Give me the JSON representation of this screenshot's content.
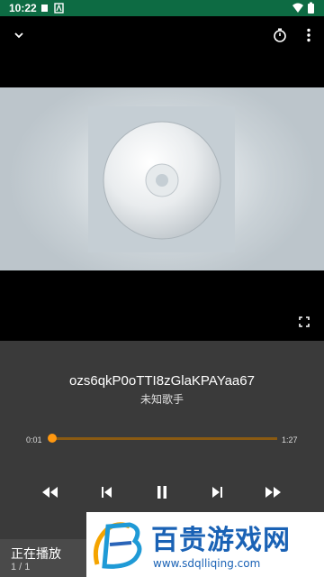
{
  "status_bar": {
    "time": "10:22"
  },
  "icons": {
    "collapse": "chevron-down-icon",
    "timer": "stopwatch-icon",
    "menu": "more-vert-icon",
    "fullscreen": "fullscreen-icon",
    "rewind": "rewind-icon",
    "previous": "skip-previous-icon",
    "pause": "pause-icon",
    "next": "skip-next-icon",
    "forward": "fast-forward-icon"
  },
  "track": {
    "title": "ozs6qkP0oTTI8zGlaKPAYaa67",
    "artist": "未知歌手"
  },
  "progress": {
    "current": "0:01",
    "duration": "1:27",
    "fraction": 0.0115
  },
  "colors": {
    "accent": "#ff9810",
    "status_bar": "#0d6b43",
    "panel": "#3a3a3a"
  },
  "now_playing": {
    "label": "正在播放",
    "count": "1 / 1"
  },
  "watermark": {
    "text": "百贵游戏网",
    "url": "www.sdqlliqing.com"
  }
}
